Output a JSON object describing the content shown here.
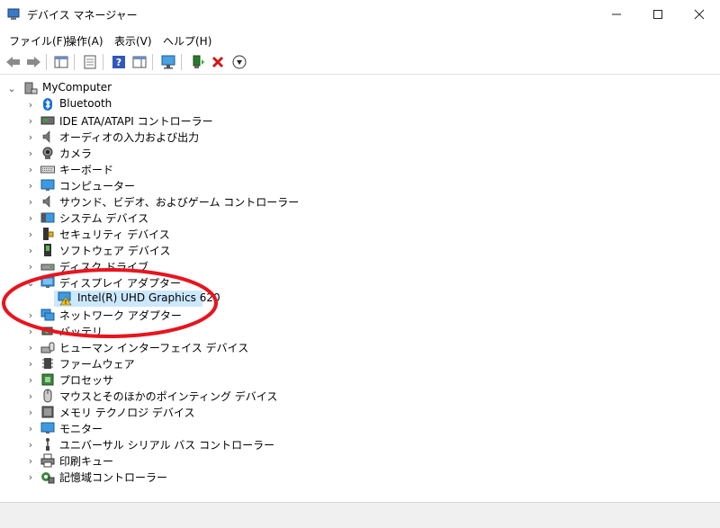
{
  "window": {
    "title": "デバイス マネージャー",
    "minimize_icon": "minimize-icon",
    "maximize_icon": "maximize-icon",
    "close_icon": "close-icon"
  },
  "menu": [
    "ファイル(F)",
    "操作(A)",
    "表示(V)",
    "ヘルプ(H)"
  ],
  "toolbar": {
    "buttons": [
      "back-arrow-icon",
      "forward-arrow-icon",
      "show-hide-tree-icon",
      "properties-icon",
      "help-icon",
      "action-pane-icon",
      "scan-hardware-icon",
      "update-driver-icon",
      "uninstall-device-icon",
      "disable-device-icon"
    ]
  },
  "tree": {
    "root": "MyComputer",
    "categories": [
      "Bluetooth",
      "IDE ATA/ATAPI コントローラー",
      "オーディオの入力および出力",
      "カメラ",
      "キーボード",
      "コンピューター",
      "サウンド、ビデオ、およびゲーム コントローラー",
      "システム デバイス",
      "セキュリティ デバイス",
      "ソフトウェア デバイス",
      "ディスク ドライブ",
      "ディスプレイ アダプター",
      "ネットワーク アダプター",
      "バッテリ",
      "ヒューマン インターフェイス デバイス",
      "ファームウェア",
      "プロセッサ",
      "マウスとそのほかのポインティング デバイス",
      "メモリ テクノロジ デバイス",
      "モニター",
      "ユニバーサル シリアル バス コントローラー",
      "印刷キュー",
      "記憶域コントローラー"
    ],
    "expanded_category": "ディスプレイ アダプター",
    "selected_device": "Intel(R) UHD Graphics 620",
    "device_status_icon": "warning-icon"
  },
  "colors": {
    "selection": "#cce8ff",
    "annotation_circle": "#e8141e",
    "warning": "#f5c400"
  }
}
